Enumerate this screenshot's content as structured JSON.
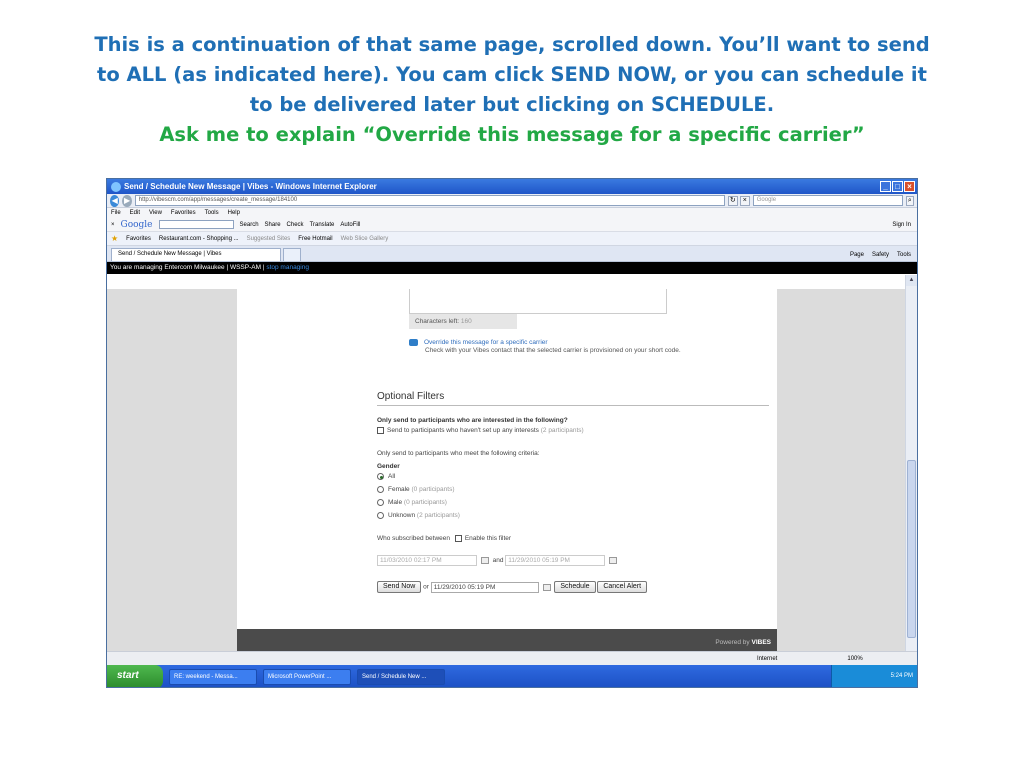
{
  "slide": {
    "line1": "This is a continuation of that same page, scrolled down. You’ll want to send",
    "line2": "to ALL (as indicated here). You cam click SEND NOW, or you can schedule it",
    "line3": "to be delivered later but clicking on SCHEDULE.",
    "line4": "Ask me to explain “Override this message for a specific carrier”",
    "colors": {
      "blue": "#1f6fb5",
      "green": "#22a845"
    }
  },
  "browser": {
    "window_title": "Send / Schedule New Message | Vibes - Windows Internet Explorer",
    "url": "http://vibescm.com/app/messages/create_message/184100",
    "search_placeholder": "Google",
    "menu": [
      "File",
      "Edit",
      "View",
      "Favorites",
      "Tools",
      "Help"
    ],
    "google_toolbar": {
      "logo": "Google",
      "items": [
        "Search",
        "Share",
        "Check",
        "Translate",
        "AutoFill"
      ],
      "signin": "Sign In"
    },
    "favorites": {
      "label": "Favorites",
      "items": [
        "Restaurant.com - Shopping ...",
        "Suggested Sites",
        "Free Hotmail",
        "Web Slice Gallery"
      ]
    },
    "tab_title": "Send / Schedule New Message | Vibes",
    "tab_tools": [
      "Page",
      "Safety",
      "Tools"
    ],
    "status": {
      "zone": "Internet",
      "zoom": "100%"
    }
  },
  "app": {
    "managing_text": "You are managing Entercom Milwaukee | WSSP-AM |",
    "stop_managing": "stop managing",
    "characters_left_label": "Characters left:",
    "characters_left_value": "160",
    "override_link": "Override this message for a specific carrier",
    "override_note": "Check with your Vibes contact that the selected carrier is provisioned on your short code.",
    "optional_filters_title": "Optional Filters",
    "interests_heading": "Only send to participants who are interested in the following?",
    "interests_option": "Send to participants who haven't set up any interests",
    "interests_count": "(2 participants)",
    "criteria_text": "Only send to participants who meet the following criteria:",
    "gender_label": "Gender",
    "gender_options": [
      {
        "label": "All",
        "count": "",
        "selected": true
      },
      {
        "label": "Female",
        "count": "(0 participants)",
        "selected": false
      },
      {
        "label": "Male",
        "count": "(0 participants)",
        "selected": false
      },
      {
        "label": "Unknown",
        "count": "(2 participants)",
        "selected": false
      }
    ],
    "subscribed_label": "Who subscribed between",
    "enable_filter_label": "Enable this filter",
    "date_from": "11/03/2010 02:17 PM",
    "and_label": "and",
    "date_to": "11/29/2010 05:19 PM",
    "send_now_label": "Send Now",
    "or_label": "or",
    "schedule_date": "11/29/2010 05:19 PM",
    "schedule_label": "Schedule",
    "cancel_label": "Cancel Alert",
    "powered_by": "Powered by",
    "powered_brand": "VIBES"
  },
  "taskbar": {
    "start": "start",
    "items": [
      "RE: weekend - Messa...",
      "Microsoft PowerPoint ...",
      "Send / Schedule New ..."
    ],
    "clock": "5:24 PM"
  }
}
